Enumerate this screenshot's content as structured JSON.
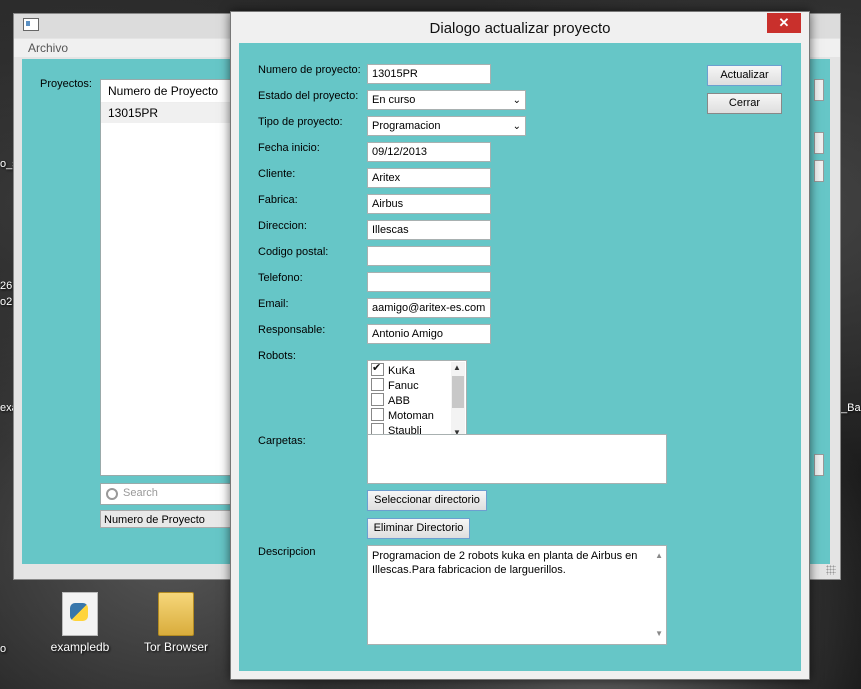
{
  "colors": {
    "accent_teal": "#66c6c7",
    "close_red": "#c9302c"
  },
  "desktop": {
    "icons": [
      {
        "label": "exampledb",
        "icon": "python-file-icon"
      },
      {
        "label": "Tor Browser",
        "icon": "folder-icon"
      }
    ],
    "edge_texts": [
      "o_s",
      "26",
      "o2",
      "exa",
      "_Ba",
      "o"
    ]
  },
  "main_window": {
    "menu": {
      "archivo": "Archivo"
    },
    "proyectos_label": "Proyectos:",
    "list_header": "Numero de Proyecto",
    "list_items": [
      "13015PR"
    ],
    "search_placeholder": "Search",
    "filter_combo": "Numero de Proyecto"
  },
  "dialog": {
    "title": "Dialogo actualizar proyecto",
    "close": "✕",
    "fields": {
      "numero": {
        "label": "Numero de proyecto:",
        "value": "13015PR"
      },
      "estado": {
        "label": "Estado del proyecto:",
        "value": "En curso"
      },
      "tipo": {
        "label": "Tipo de proyecto:",
        "value": "Programacion"
      },
      "fecha": {
        "label": "Fecha inicio:",
        "value": "09/12/2013"
      },
      "cliente": {
        "label": "Cliente:",
        "value": "Aritex"
      },
      "fabrica": {
        "label": "Fabrica:",
        "value": "Airbus"
      },
      "direccion": {
        "label": "Direccion:",
        "value": "Illescas"
      },
      "codigo_postal": {
        "label": "Codigo postal:",
        "value": ""
      },
      "telefono": {
        "label": "Telefono:",
        "value": ""
      },
      "email": {
        "label": "Email:",
        "value": "aamigo@aritex-es.com"
      },
      "responsable": {
        "label": "Responsable:",
        "value": "Antonio Amigo"
      }
    },
    "robots": {
      "label": "Robots:",
      "items": [
        {
          "name": "KuKa",
          "checked": true
        },
        {
          "name": "Fanuc",
          "checked": false
        },
        {
          "name": "ABB",
          "checked": false
        },
        {
          "name": "Motoman",
          "checked": false
        },
        {
          "name": "Staubli",
          "checked": false
        }
      ]
    },
    "carpetas_label": "Carpetas:",
    "select_dir_button": "Seleccionar directorio",
    "delete_dir_button": "Eliminar Directorio",
    "descripcion_label": "Descripcion",
    "descripcion_value": "Programacion de 2 robots kuka en planta de Airbus en Illescas.Para fabricacion de larguerillos.",
    "actualizar_button": "Actualizar",
    "cerrar_button": "Cerrar"
  }
}
